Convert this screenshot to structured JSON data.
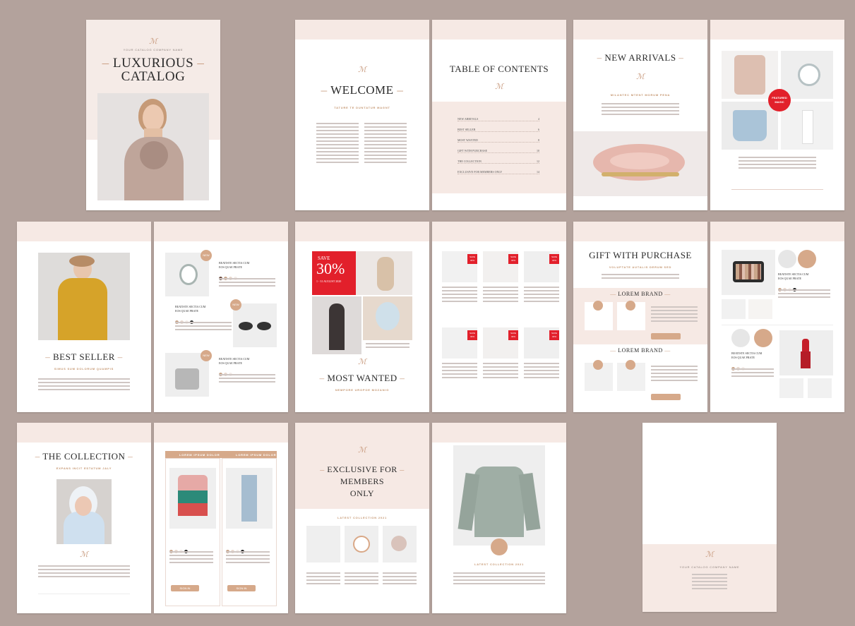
{
  "logo_mark": "ℳ",
  "cover": {
    "title_line1": "LUXURIOUS",
    "title_line2": "CATALOG",
    "tagline": "YOUR CATALOG COMPANY NAME"
  },
  "welcome": {
    "title": "WELCOME",
    "subtitle": "TATURE TE DUNTATUR MAGNT"
  },
  "toc": {
    "title": "TABLE OF CONTENTS",
    "entries": [
      {
        "label": "NEW ARRIVALS",
        "page": "4"
      },
      {
        "label": "BEST SELLER",
        "page": "6"
      },
      {
        "label": "MOST WANTED",
        "page": "8"
      },
      {
        "label": "GIFT WITH PURCHASE",
        "page": "10"
      },
      {
        "label": "THE COLLECTION",
        "page": "12"
      },
      {
        "label": "EXCLUSIVE FOR MEMBERS ONLY",
        "page": "14"
      }
    ]
  },
  "new_arrivals": {
    "title": "NEW ARRIVALS",
    "subtitle": "MILANTEC MTENT MORUM PENA"
  },
  "featured": {
    "badge_line1": "FEATURED",
    "badge_line2": "MAGIC"
  },
  "best_seller": {
    "title": "BEST SELLER",
    "subtitle": "SIMUS SUM DOLORUM QUAMPIS"
  },
  "products_page": {
    "new_badge": "NEW",
    "product_name_line1": "BEATISTE SECTIA CUM",
    "product_name_line2": "EOS QUAE PRATE",
    "size_label": "SIZE"
  },
  "most_wanted": {
    "title": "MOST WANTED",
    "subtitle": "NEMPORE UROPOE MOZANIG",
    "sale_label": "SAVE",
    "sale_value": "30%",
    "sale_dates": "1 - 31 AUGUST 2020"
  },
  "sale_grid": {
    "badge_line1": "SAVE",
    "badge_line2": "30%"
  },
  "gift": {
    "title": "GIFT WITH PURCHASE",
    "subtitle": "VOLUPTATE AUTALIS DERUM SED",
    "brand1": "LOREM BRAND",
    "brand2": "LOREM BRAND"
  },
  "beauty": {
    "product_name_line1": "BEATISTE SECTIA CUM",
    "product_name_line2": "EOS QUAE PRATE"
  },
  "collection": {
    "title": "THE COLLECTION",
    "subtitle": "EXPANS INCIT ESTATUM JALY"
  },
  "knit_page": {
    "tab1": "LOREM IPSUM DOLOR",
    "tab2": "LOREM IPSUM DOLOR",
    "button": "SIGN IN"
  },
  "exclusive": {
    "title_line1": "EXCLUSIVE FOR",
    "title_line2": "MEMBERS",
    "title_line3": "ONLY",
    "section": "LATEST COLLECTION 2021"
  },
  "sweater_page": {
    "caption": "LATEST COLLECTION 2021"
  },
  "back_cover": {
    "company": "YOUR CATALOG COMPANY NAME"
  },
  "colors": {
    "background": "#b3a29c",
    "blush": "#f6e9e4",
    "accent": "#c99c80",
    "sale_red": "#e2202b"
  }
}
